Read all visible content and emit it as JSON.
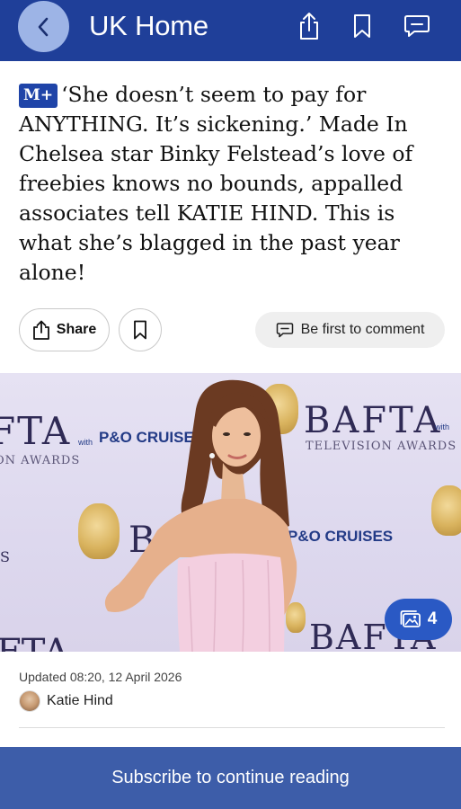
{
  "header": {
    "title": "UK Home"
  },
  "article": {
    "badge": "M+",
    "headline": "‘She doesn’t seem to pay for ANYTHING. It’s sickening.’ Made In Chelsea star Binky Felstead’s love of freebies knows no bounds, appalled associates tell KATIE HIND. This is what she’s blagged in the past year alone!",
    "share_label": "Share",
    "comment_label": "Be first to comment",
    "gallery_count": "4",
    "updated": "Updated 08:20, 12 April 2026",
    "author": "Katie Hind"
  },
  "hero_image": {
    "backdrop_text": {
      "bafta": "BAFTA",
      "bafta_left": "FTA",
      "bafta_bottom_left": "FTA",
      "bafta_bottom_right": "BAFTA",
      "television_awards": "TELEVISION AWARDS",
      "television_awards_left": "ON AWARDS",
      "with": "with",
      "po_cruises": "P&O CRUISES",
      "po_cruises_mid": "P&O CRUISES",
      "partial_b": "B",
      "partial_s": "S"
    }
  },
  "footer": {
    "subscribe_label": "Subscribe to continue reading"
  },
  "colors": {
    "header_bg": "#1f3f99",
    "subscribe_bg": "#3d5da9",
    "gallery_bg": "#2a59c4"
  }
}
